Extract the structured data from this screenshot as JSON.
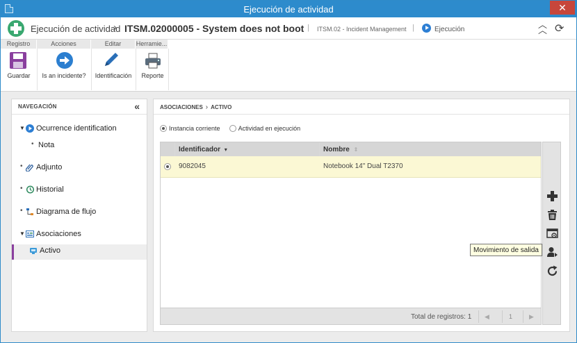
{
  "window": {
    "title": "Ejecución de actividad",
    "close": "✕"
  },
  "header": {
    "crumb": "Ejecución de actividad",
    "record": "ITSM.02000005 - System does not boot",
    "module": "ITSM.02 - Incident Management",
    "status": "Ejecución"
  },
  "toolbar": {
    "groups": [
      "Registro",
      "Acciones",
      "Editar",
      "Herramie..."
    ],
    "buttons": {
      "save": "Guardar",
      "is_incident": "Is an incidente?",
      "identification": "Identificación",
      "report": "Reporte"
    }
  },
  "nav": {
    "title": "NAVEGACIÓN",
    "items": [
      "Ocurrence identification",
      "Nota",
      "Adjunto",
      "Historial",
      "Diagrama de flujo",
      "Asociaciones",
      "Activo"
    ]
  },
  "content": {
    "breadcrumb": {
      "parent": "ASOCIACIONES",
      "current": "ACTIVO"
    },
    "radio": {
      "option1": "Instancia corriente",
      "option2": "Actividad en ejecución",
      "selected": "Instancia corriente"
    },
    "grid": {
      "columns": [
        "Identificador",
        "Nombre"
      ],
      "rows": [
        {
          "id": "9082045",
          "name": "Notebook 14\" Dual T2370"
        }
      ],
      "total": "Total de registros: 1",
      "page": "1"
    }
  },
  "tooltip": "Movimiento de salida",
  "colors": {
    "titlebar": "#2d8bcc",
    "accent": "#8a3f9e",
    "row_highlight": "#fbf8d4",
    "close": "#c7463b"
  }
}
